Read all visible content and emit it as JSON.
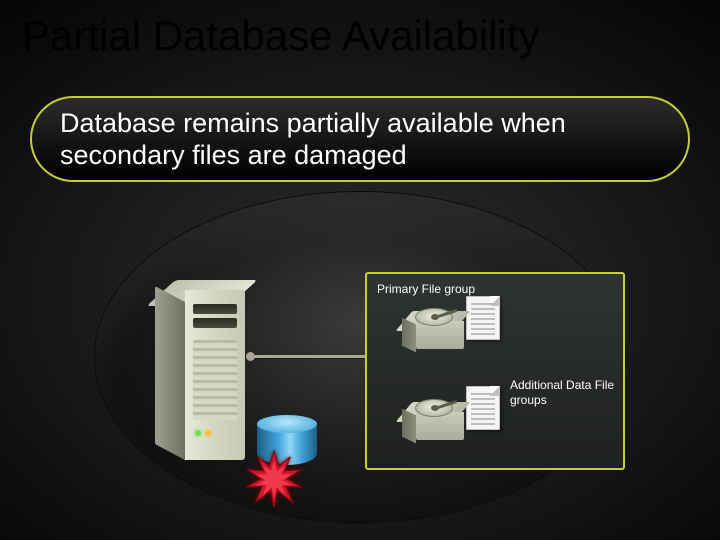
{
  "title": "Partial Database Availability",
  "subtitle": "Database remains partially available when secondary files are damaged",
  "panel": {
    "primary_label": "Primary File group",
    "additional_label": "Additional Data File groups"
  },
  "icons": {
    "server": "server-tower",
    "database": "database-cylinder",
    "burst": "explosion-star",
    "disk": "hard-disk",
    "document": "file-page"
  }
}
